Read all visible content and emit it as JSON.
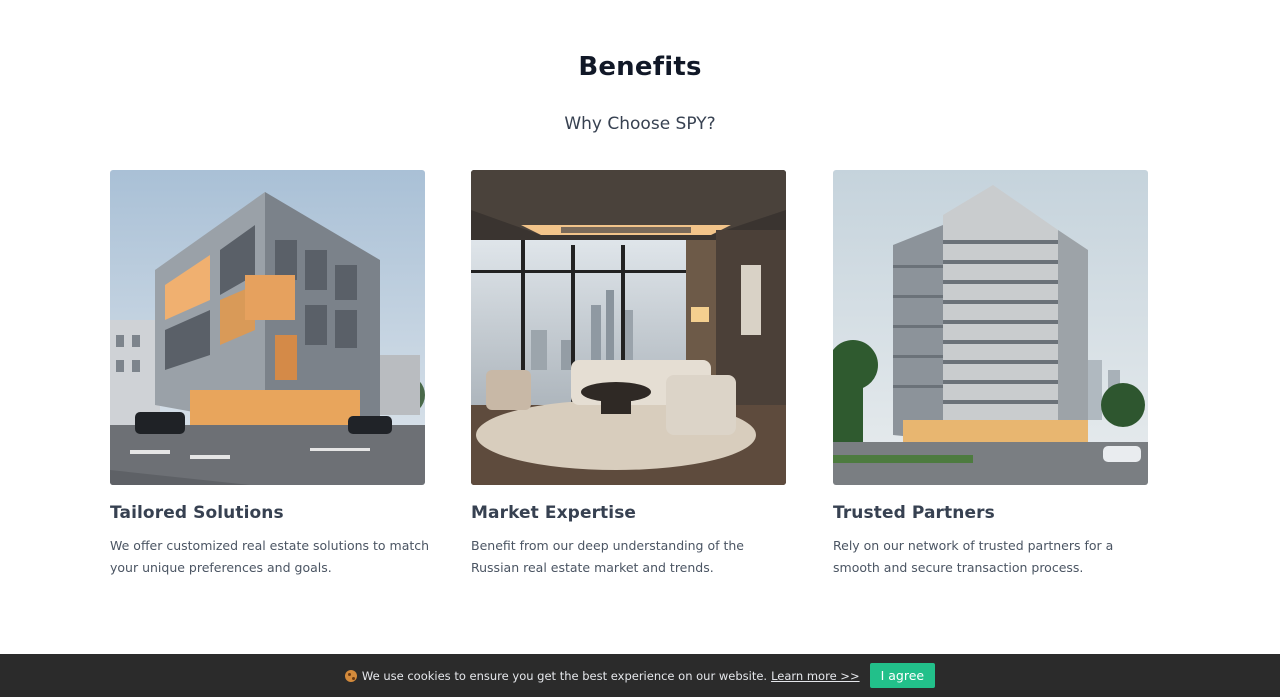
{
  "section": {
    "title": "Benefits",
    "subtitle": "Why Choose SPY?"
  },
  "cards": [
    {
      "title": "Tailored Solutions",
      "text": "We offer customized real estate solutions to match your unique preferences and goals.",
      "image": "modern-office-building-photo"
    },
    {
      "title": "Market Expertise",
      "text": "Benefit from our deep understanding of the Russian real estate market and trends.",
      "image": "luxury-living-room-photo"
    },
    {
      "title": "Trusted Partners",
      "text": "Rely on our network of trusted partners for a smooth and secure transaction process.",
      "image": "residential-tower-photo"
    }
  ],
  "cookie_bar": {
    "message": "We use cookies to ensure you get the best experience on our website.",
    "learn_more": "Learn more >>",
    "agree_label": "I agree",
    "icon": "cookie-icon"
  },
  "colors": {
    "agree_button": "#22c08a",
    "cookie_bar_bg": "#2b2b2b"
  }
}
